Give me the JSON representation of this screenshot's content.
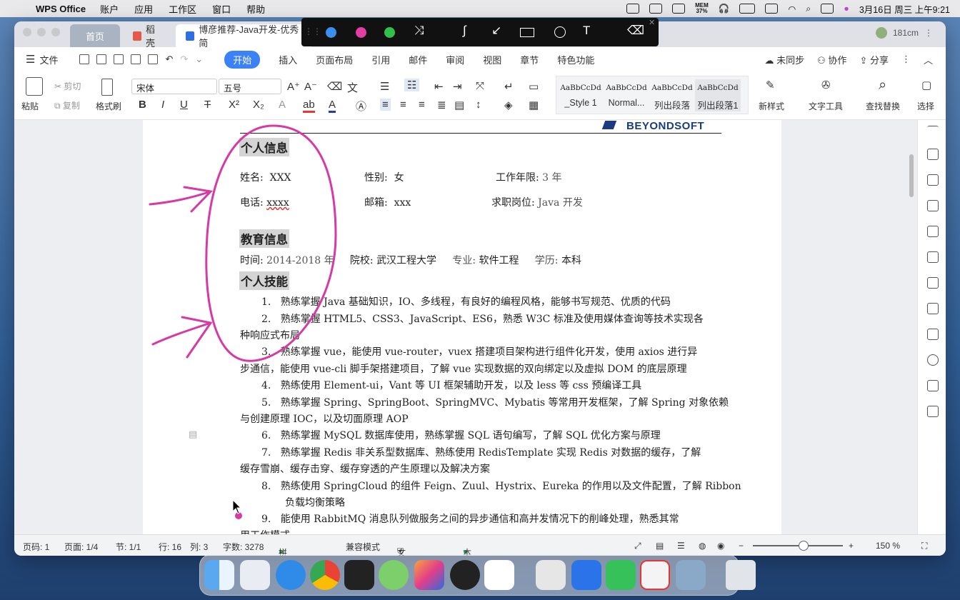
{
  "menubar": {
    "app_name": "WPS Office",
    "items": [
      "账户",
      "应用",
      "工作区",
      "窗口",
      "帮助"
    ],
    "mem": "MEM",
    "mem_pct": "37%",
    "datetime": "3月16日 周三 上午9:21"
  },
  "tabs": {
    "home": "首页",
    "daoke": "稻壳",
    "doc": "博彦推荐-Java开发-优秀简"
  },
  "user": {
    "count": "181cm"
  },
  "ribbon": {
    "file": "文件",
    "tabs": [
      "开始",
      "插入",
      "页面布局",
      "引用",
      "邮件",
      "审阅",
      "视图",
      "章节",
      "特色功能"
    ],
    "unsynced": "未同步",
    "collab": "协作",
    "share": "分享"
  },
  "toolbar": {
    "paste": "粘贴",
    "cut": "剪切",
    "copy": "复制",
    "format_painter": "格式刷",
    "font": "宋体",
    "size": "五号",
    "styles": [
      {
        "preview": "AaBbCcDd",
        "label": "_Style 1"
      },
      {
        "preview": "AaBbCcDd",
        "label": "Normal..."
      },
      {
        "preview": "AaBbCcDd",
        "label": "列出段落"
      },
      {
        "preview": "AaBbCcDd",
        "label": "列出段落1"
      }
    ],
    "new_style": "新样式",
    "text_tools": "文字工具",
    "find_replace": "查找替换",
    "select": "选择"
  },
  "doc": {
    "logo": "BEYONDSOFT",
    "h_personal": "个人信息",
    "name_label": "姓名:",
    "name_val": "XXX",
    "gender_label": "性别:",
    "gender_val": "女",
    "years_label": "工作年限:",
    "years_val": "3 年",
    "phone_label": "电话:",
    "phone_val": "xxxx",
    "email_label": "邮箱:",
    "email_val": "xxx",
    "job_label": "求职岗位:",
    "job_val": "Java 开发",
    "h_edu": "教育信息",
    "time_label": "时间:",
    "time_val": "2014-2018 年",
    "school_label": "院校:",
    "school_val": "武汉工程大学",
    "major_label": "专业:",
    "major_val": "软件工程",
    "degree_label": "学历:",
    "degree_val": "本科",
    "h_skills": "个人技能",
    "skills": [
      {
        "n": "1.",
        "t": "熟练掌握 Java 基础知识，IO、多线程，有良好的编程风格，能够书写规范、优质的代码"
      },
      {
        "n": "2.",
        "t": "熟练掌握 HTML5、CSS3、JavaScript、ES6，熟悉 W3C 标准及使用媒体查询等技术实现各",
        "c": "种响应式布局"
      },
      {
        "n": "3.",
        "t": "熟练掌握 vue，能使用 vue-router，vuex 搭建项目架构进行组件化开发，使用 axios 进行异",
        "c": "步通信，能使用 vue-cli 脚手架搭建项目，了解 vue 实现数据的双向绑定以及虚拟 DOM 的底层原理"
      },
      {
        "n": "4.",
        "t": "熟练使用 Element-ui，Vant 等 UI 框架辅助开发，以及 less 等 css 预编译工具"
      },
      {
        "n": "5.",
        "t": "熟练掌握 Spring、SpringBoot、SpringMVC、Mybatis 等常用开发框架，了解 Spring 对象依赖",
        "c": "与创建原理 IOC，以及切面原理 AOP"
      },
      {
        "n": "6.",
        "t": "熟练掌握 MySQL 数据库使用，熟练掌握 SQL 语句编写，了解 SQL 优化方案与原理"
      },
      {
        "n": "7.",
        "t": "熟练掌握 Redis 非关系型数据库、熟练使用 RedisTemplate 实现 Redis 对数据的缓存，了解",
        "c": "缓存雪崩、缓存击穿、缓存穿透的产生原理以及解决方案"
      },
      {
        "n": "8.",
        "t": "熟练使用 SpringCloud 的组件 Feign、Zuul、Hystrix、Eureka 的作用以及文件配置，了解 Ribbon",
        "c2": "负载均衡策略"
      },
      {
        "n": "9.",
        "t": "能使用 RabbitMQ 消息队列做服务之间的异步通信和高并发情况下的削峰处理，熟悉其常",
        "c": "用工作模式"
      }
    ]
  },
  "status": {
    "pages_code": "页码: 1",
    "page": "页面: 1/4",
    "section": "节: 1/1",
    "row": "行: 16",
    "col": "列: 3",
    "words": "字数: 3278",
    "spell": "拼写检查",
    "compat": "兼容模式",
    "protect": "文档未保护",
    "backup": "本地备份开",
    "zoom": "150 %"
  },
  "colors": {
    "accent": "#3b82f6",
    "pen": "#d63aa3",
    "blue_dot": "#3b8df0",
    "pink_dot": "#e23ea4",
    "green_dot": "#33c04a"
  }
}
